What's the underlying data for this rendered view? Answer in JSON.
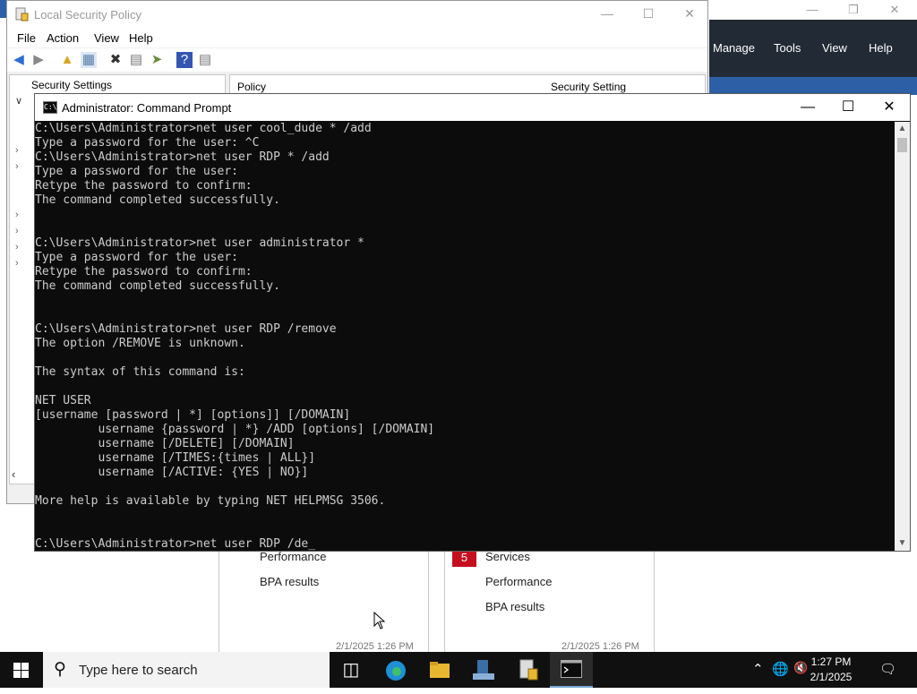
{
  "server_manager": {
    "menus": [
      "Manage",
      "Tools",
      "View",
      "Help"
    ],
    "tiles": [
      {
        "items": [
          "Performance",
          "BPA results"
        ],
        "timestamp": "2/1/2025 1:26 PM"
      },
      {
        "badge": "5",
        "items": [
          "Services",
          "Performance",
          "BPA results"
        ],
        "timestamp": "2/1/2025 1:26 PM"
      }
    ]
  },
  "lsp": {
    "title": "Local Security Policy",
    "menus": [
      "File",
      "Action",
      "View",
      "Help"
    ],
    "tree_header": "Security Settings",
    "columns": {
      "policy": "Policy",
      "setting": "Security Setting"
    }
  },
  "cmd": {
    "title": "Administrator: Command Prompt",
    "lines": [
      "C:\\Users\\Administrator>net user cool_dude * /add",
      "Type a password for the user: ^C",
      "C:\\Users\\Administrator>net user RDP * /add",
      "Type a password for the user:",
      "Retype the password to confirm:",
      "The command completed successfully.",
      "",
      "",
      "C:\\Users\\Administrator>net user administrator *",
      "Type a password for the user:",
      "Retype the password to confirm:",
      "The command completed successfully.",
      "",
      "",
      "C:\\Users\\Administrator>net user RDP /remove",
      "The option /REMOVE is unknown.",
      "",
      "The syntax of this command is:",
      "",
      "NET USER",
      "[username [password | *] [options]] [/DOMAIN]",
      "         username {password | *} /ADD [options] [/DOMAIN]",
      "         username [/DELETE] [/DOMAIN]",
      "         username [/TIMES:{times | ALL}]",
      "         username [/ACTIVE: {YES | NO}]",
      "",
      "More help is available by typing NET HELPMSG 3506.",
      "",
      "",
      "C:\\Users\\Administrator>net user RDP /de_"
    ]
  },
  "taskbar": {
    "search_placeholder": "Type here to search",
    "time": "1:27 PM",
    "date": "2/1/2025",
    "apps": [
      "task-view-icon",
      "edge-icon",
      "file-explorer-icon",
      "server-manager-icon",
      "local-security-policy-icon",
      "command-prompt-icon"
    ]
  },
  "colors": {
    "cmd_background": "#0c0c0c",
    "cmd_text": "#cccccc",
    "taskbar": "#101010",
    "server_manager_menubar": "#222a35",
    "alert_badge": "#c50f1f"
  }
}
